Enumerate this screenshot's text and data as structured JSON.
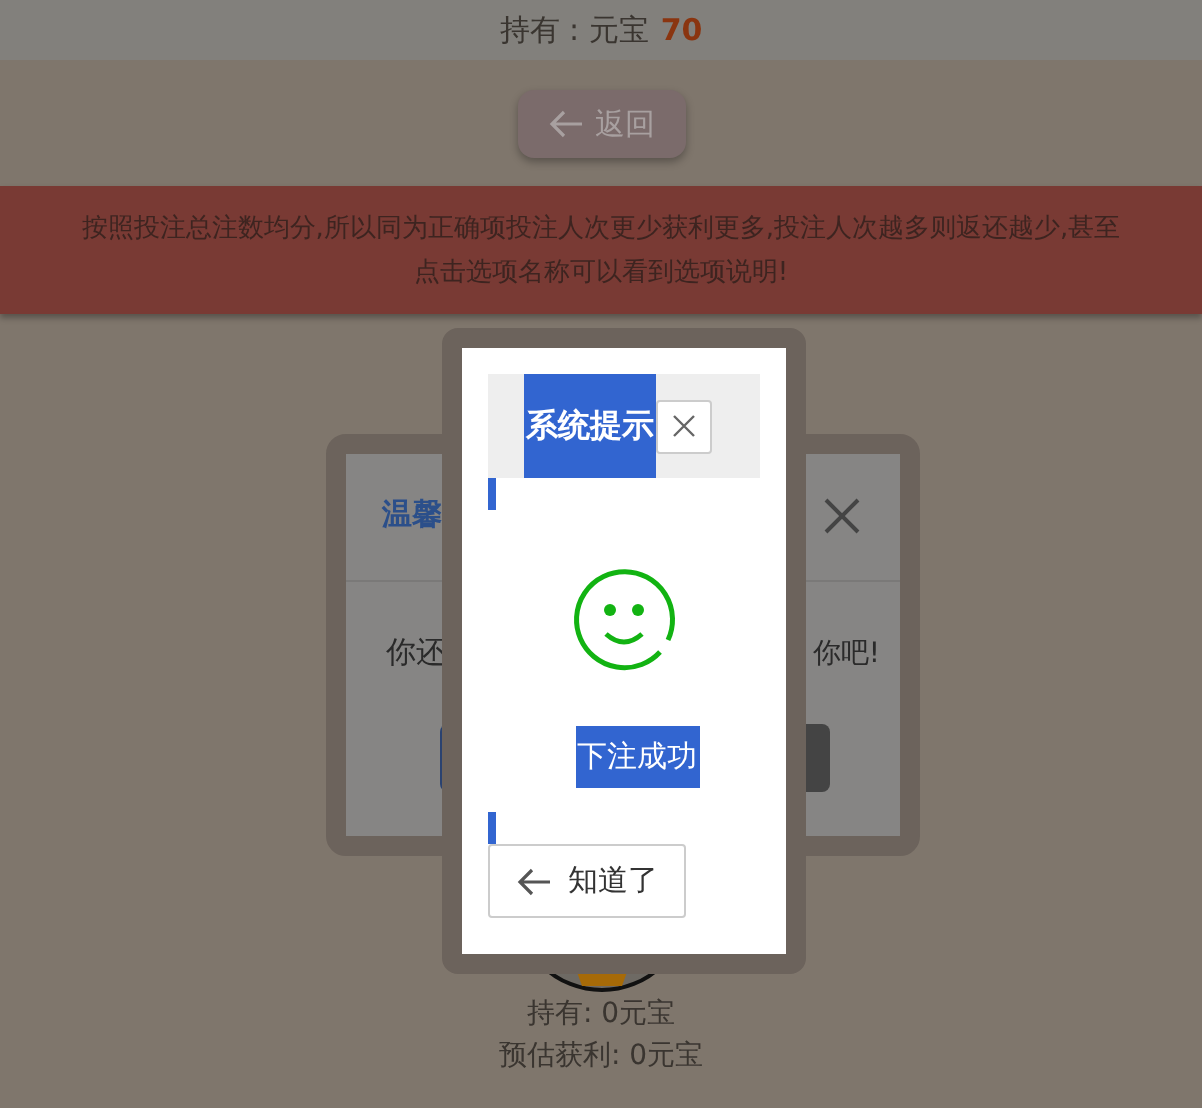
{
  "balance": {
    "label": "持有 : 元宝",
    "amount": "70"
  },
  "back_button": {
    "label": "返回"
  },
  "notice": {
    "lines": [
      "按照投注总注数均分,所以同为正确项投注人次更少获利更多,投注人次越多则返还越少,甚至",
      "点击选项名称可以看到选项说明!"
    ]
  },
  "background_dialog": {
    "title": "温馨",
    "body_left": "你还",
    "body_right": "你吧!"
  },
  "summary": {
    "held": "持有: 0元宝",
    "estimated": "预估获利: 0元宝"
  },
  "dialog": {
    "title": "系统提示",
    "message": "下注成功",
    "button": "知道了"
  }
}
